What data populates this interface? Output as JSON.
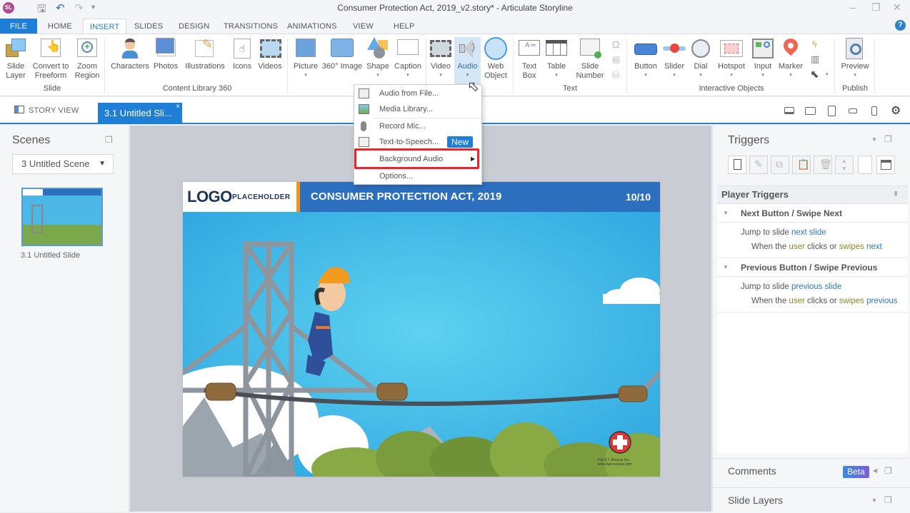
{
  "window": {
    "app_logo": "SL",
    "title": "Consumer Protection Act, 2019_v2.story* - Articulate Storyline",
    "quick_access": [
      "save-icon",
      "undo-icon",
      "redo-icon",
      "customize-icon"
    ],
    "controls": {
      "minimize": "–",
      "restore": "❐",
      "close": "✕"
    },
    "help": "?"
  },
  "menu_tabs": [
    {
      "label": "FILE"
    },
    {
      "label": "HOME"
    },
    {
      "label": "INSERT",
      "active": true
    },
    {
      "label": "SLIDES"
    },
    {
      "label": "DESIGN"
    },
    {
      "label": "TRANSITIONS"
    },
    {
      "label": "ANIMATIONS"
    },
    {
      "label": "VIEW"
    },
    {
      "label": "HELP"
    }
  ],
  "ribbon": {
    "groups": {
      "slide": "Slide",
      "content_library": "Content Library 360",
      "text": "Text",
      "interactive": "Interactive Objects",
      "publish": "Publish"
    },
    "buttons": {
      "slide_layer": [
        "Slide",
        "Layer"
      ],
      "convert_freeform": [
        "Convert to",
        "Freeform"
      ],
      "zoom_region": [
        "Zoom",
        "Region"
      ],
      "characters": "Characters",
      "photos": "Photos",
      "illustrations": "Illustrations",
      "icons": "Icons",
      "videos": "Videos",
      "picture": "Picture",
      "image360": "360° Image",
      "shape": "Shape",
      "caption": "Caption",
      "video": "Video",
      "audio": "Audio",
      "web_object": [
        "Web",
        "Object"
      ],
      "text_box": [
        "Text",
        "Box"
      ],
      "table": "Table",
      "slide_number": [
        "Slide",
        "Number"
      ],
      "button": "Button",
      "slider": "Slider",
      "dial": "Dial",
      "hotspot": "Hotspot",
      "input": "Input",
      "marker": "Marker",
      "preview": "Preview"
    },
    "small_icons": [
      "symbol-icon",
      "equation-icon",
      "reference-icon",
      "trigger-icon",
      "layout-icon",
      "cursor-icon"
    ]
  },
  "audio_menu": {
    "items": [
      {
        "label": "Audio from File...",
        "icon": "audio-file-icon"
      },
      {
        "label": "Media Library...",
        "icon": "media-library-icon"
      },
      {
        "label": "Record Mic...",
        "icon": "microphone-icon"
      },
      {
        "label": "Text-to-Speech...",
        "icon": "text-to-speech-icon",
        "badge": "New"
      },
      {
        "label": "Background Audio",
        "submenu": true,
        "highlighted": true
      },
      {
        "label": "Options..."
      }
    ]
  },
  "view_tabs": {
    "story_view": "STORY VIEW",
    "slide_tab": "3.1 Untitled Sli...",
    "close": "×",
    "device_icons": [
      "desktop-icon",
      "tablet-landscape-icon",
      "tablet-portrait-icon",
      "phone-landscape-icon",
      "phone-portrait-icon",
      "settings-gear-icon"
    ]
  },
  "scenes_panel": {
    "title": "Scenes",
    "selected_scene": "3 Untitled Scene",
    "slides": [
      {
        "label": "3.1 Untitled Slide"
      }
    ]
  },
  "slide": {
    "logo": "LOGO",
    "logo_sub": "PLACEHOLDER",
    "title": "CONSUMER PROTECTION ACT, 2019",
    "page": "10/10",
    "watermark": [
      "F.A.S.T. Rescue Inc.",
      "www.fast-rescue.com"
    ],
    "colors": {
      "header": "#2c6fbe",
      "accent": "#f39419",
      "sky": "#4ab8e6"
    }
  },
  "triggers_panel": {
    "title": "Triggers",
    "toolbar": [
      "new-trigger-icon",
      "edit-trigger-icon",
      "copy-icon",
      "paste-icon",
      "delete-icon",
      "move-up-down-icon",
      "blank",
      "variables-icon"
    ],
    "section": "Player Triggers",
    "triggers": [
      {
        "name": "Next Button / Swipe Next",
        "action_prefix": "Jump to slide ",
        "action_target": "next slide",
        "cond_prefix": "When the ",
        "cond_user": "user",
        "cond_mid": " clicks or ",
        "cond_swipes": "swipes",
        "cond_target": " next"
      },
      {
        "name": "Previous Button / Swipe Previous",
        "action_prefix": "Jump to slide ",
        "action_target": "previous slide",
        "cond_prefix": "When the ",
        "cond_user": "user",
        "cond_mid": " clicks or ",
        "cond_swipes": "swipes",
        "cond_target": " previous"
      }
    ]
  },
  "comments_panel": {
    "title": "Comments",
    "badge": "Beta"
  },
  "slide_layers_panel": {
    "title": "Slide Layers"
  }
}
